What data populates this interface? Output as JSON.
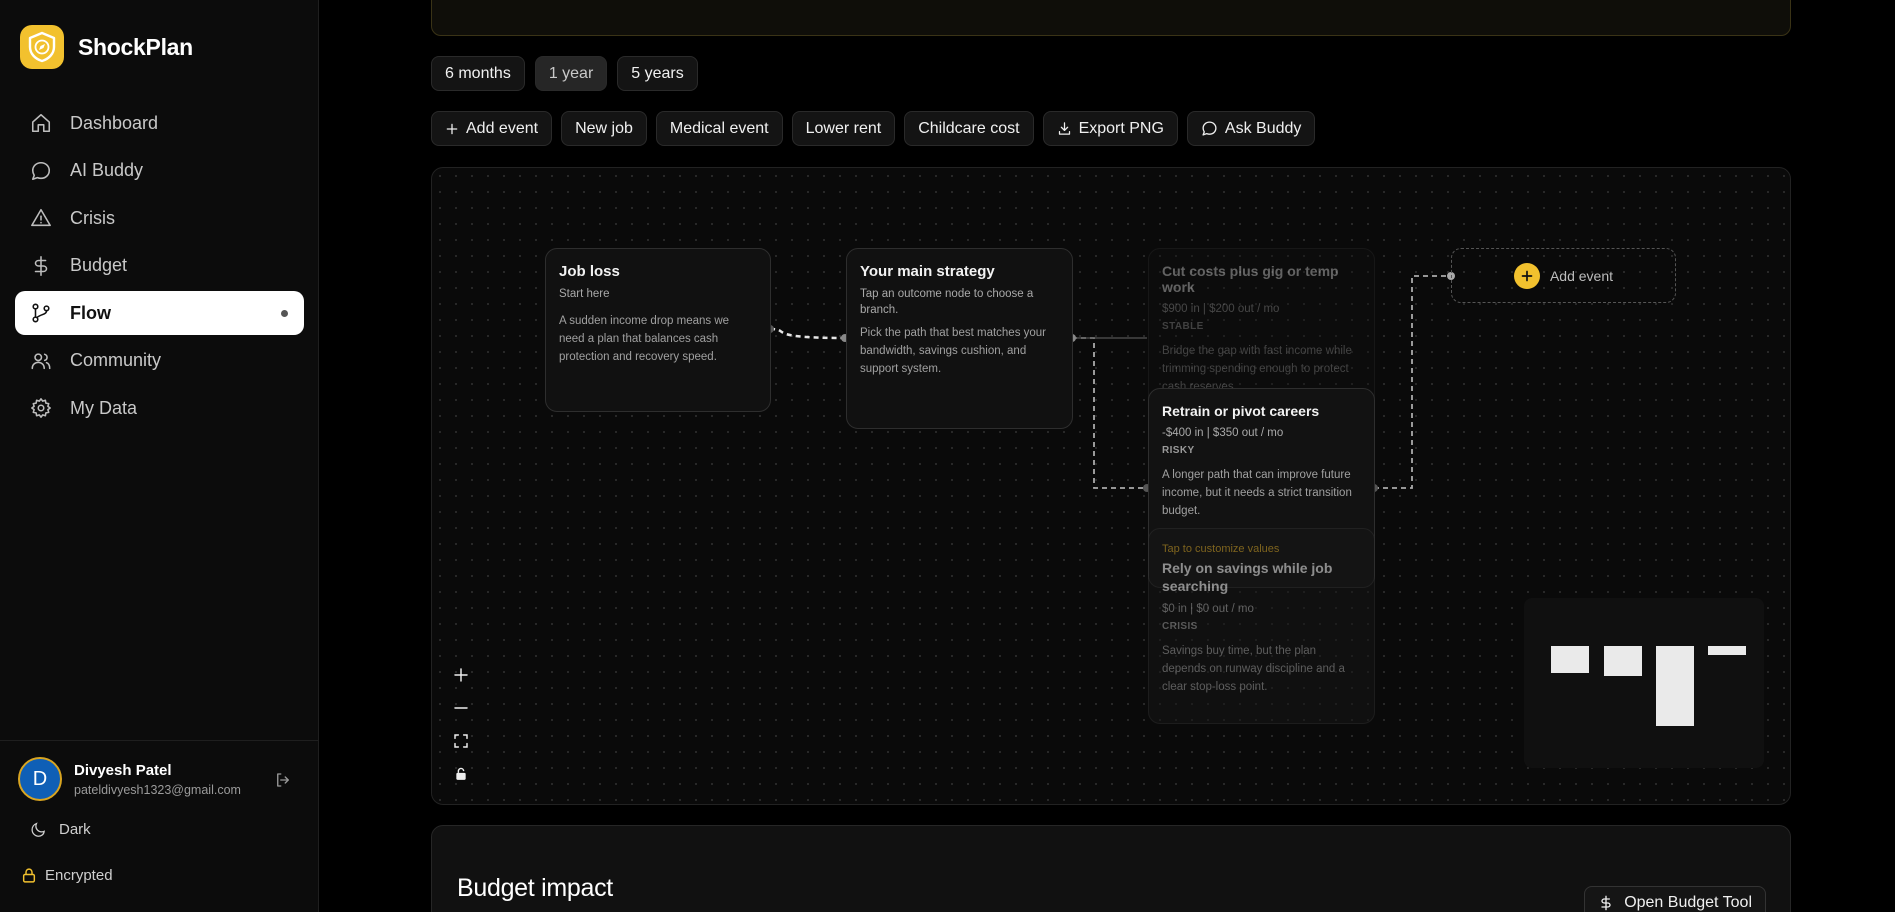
{
  "app": {
    "name": "ShockPlan"
  },
  "sidebar": {
    "items": [
      {
        "label": "Dashboard",
        "icon": "home-icon"
      },
      {
        "label": "AI Buddy",
        "icon": "chat-bubble-icon"
      },
      {
        "label": "Crisis",
        "icon": "warning-icon"
      },
      {
        "label": "Budget",
        "icon": "dollar-icon"
      },
      {
        "label": "Flow",
        "icon": "git-branch-icon",
        "active": true
      },
      {
        "label": "Community",
        "icon": "users-icon"
      },
      {
        "label": "My Data",
        "icon": "gear-icon"
      }
    ],
    "user": {
      "initial": "D",
      "name": "Divyesh Patel",
      "email": "pateldivyesh1323@gmail.com"
    },
    "theme_label": "Dark",
    "encrypted_label": "Encrypted"
  },
  "ranges": [
    {
      "label": "6 months"
    },
    {
      "label": "1 year",
      "selected": true
    },
    {
      "label": "5 years"
    }
  ],
  "actions": [
    {
      "label": "Add event",
      "icon": "plus-icon"
    },
    {
      "label": "New job"
    },
    {
      "label": "Medical event"
    },
    {
      "label": "Lower rent"
    },
    {
      "label": "Childcare cost"
    },
    {
      "label": "Export PNG",
      "icon": "download-icon"
    },
    {
      "label": "Ask Buddy",
      "icon": "chat-bubble-icon"
    }
  ],
  "flow": {
    "job_loss": {
      "title": "Job loss",
      "sub": "Start here",
      "desc": "A sudden income drop means we need a plan that balances cash protection and recovery speed."
    },
    "strategy": {
      "title": "Your main strategy",
      "sub": "Tap an outcome node to choose a branch.",
      "desc": "Pick the path that best matches your bandwidth, savings cushion, and support system."
    },
    "cut_costs": {
      "title": "Cut costs plus gig or temp work",
      "amounts": "$900 in | $200 out / mo",
      "tag": "STABLE",
      "desc": "Bridge the gap with fast income while trimming spending enough to protect cash reserves."
    },
    "retrain": {
      "title": "Retrain or pivot careers",
      "amounts": "-$400 in | $350 out / mo",
      "tag": "RISKY",
      "desc": "A longer path that can improve future income, but it needs a strict transition budget."
    },
    "savings": {
      "hint": "Tap to customize values",
      "title": "Rely on savings while job searching",
      "amounts": "$0 in | $0 out / mo",
      "tag": "CRISIS",
      "desc": "Savings buy time, but the plan depends on runway discipline and a clear stop-loss point."
    },
    "add_event": {
      "label": "Add event"
    }
  },
  "budget": {
    "title": "Budget impact",
    "button": "Open Budget Tool"
  },
  "colors": {
    "accent": "#f2c12e",
    "active_nav_bg": "#ffffff",
    "avatar_bg": "#0f5fb6"
  }
}
